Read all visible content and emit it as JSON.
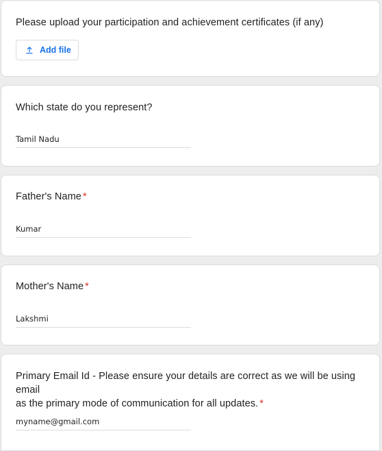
{
  "certificates": {
    "question": "Please upload your participation and achievement certificates (if any)",
    "add_file_label": "Add file"
  },
  "state": {
    "question": "Which state do you represent?",
    "value": "Tamil Nadu"
  },
  "father": {
    "question": "Father's Name",
    "required_mark": "*",
    "value": "Kumar"
  },
  "mother": {
    "question": "Mother's Name",
    "required_mark": "*",
    "value": "Lakshmi"
  },
  "email": {
    "question_line1": "Primary Email Id - Please ensure your details are correct as we will be using email",
    "question_line2": "as the primary mode of communication for all updates.",
    "required_mark": "*",
    "value": "myname@gmail.com"
  },
  "colors": {
    "accent": "#1a73e8",
    "required": "#d93025",
    "background": "#ededed"
  },
  "icons": {
    "upload": "upload-icon"
  }
}
